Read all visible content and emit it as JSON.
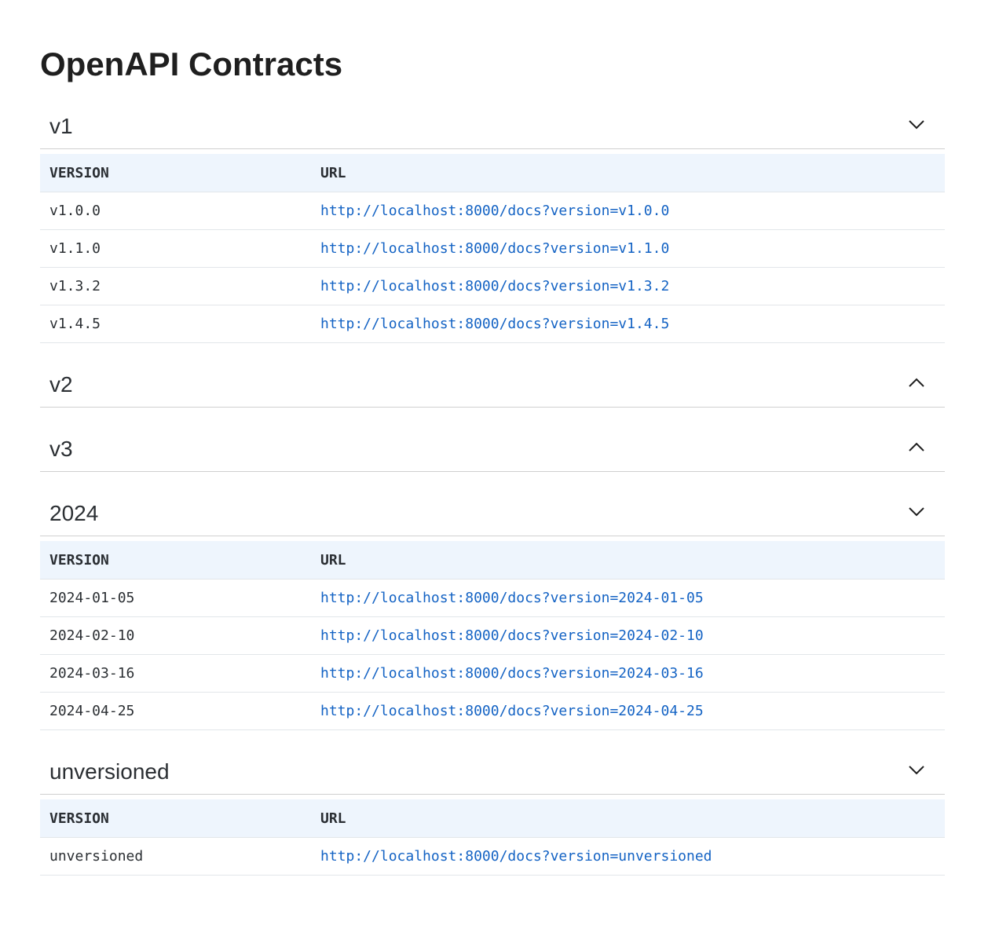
{
  "page": {
    "title": "OpenAPI Contracts"
  },
  "table_headers": {
    "version": "VERSION",
    "url": "URL"
  },
  "groups": [
    {
      "title": "v1",
      "expanded": true,
      "chevron_icon": "chevron-down-icon",
      "rows": [
        {
          "version": "v1.0.0",
          "url": "http://localhost:8000/docs?version=v1.0.0"
        },
        {
          "version": "v1.1.0",
          "url": "http://localhost:8000/docs?version=v1.1.0"
        },
        {
          "version": "v1.3.2",
          "url": "http://localhost:8000/docs?version=v1.3.2"
        },
        {
          "version": "v1.4.5",
          "url": "http://localhost:8000/docs?version=v1.4.5"
        }
      ]
    },
    {
      "title": "v2",
      "expanded": false,
      "chevron_icon": "chevron-up-icon",
      "rows": []
    },
    {
      "title": "v3",
      "expanded": false,
      "chevron_icon": "chevron-up-icon",
      "rows": []
    },
    {
      "title": "2024",
      "expanded": true,
      "chevron_icon": "chevron-down-icon",
      "rows": [
        {
          "version": "2024-01-05",
          "url": "http://localhost:8000/docs?version=2024-01-05"
        },
        {
          "version": "2024-02-10",
          "url": "http://localhost:8000/docs?version=2024-02-10"
        },
        {
          "version": "2024-03-16",
          "url": "http://localhost:8000/docs?version=2024-03-16"
        },
        {
          "version": "2024-04-25",
          "url": "http://localhost:8000/docs?version=2024-04-25"
        }
      ]
    },
    {
      "title": "unversioned",
      "expanded": true,
      "chevron_icon": "chevron-down-icon",
      "rows": [
        {
          "version": "unversioned",
          "url": "http://localhost:8000/docs?version=unversioned"
        }
      ]
    }
  ],
  "colors": {
    "link": "#1463c4",
    "header_bg": "#eef5fd",
    "divider": "#d0d0d0"
  }
}
